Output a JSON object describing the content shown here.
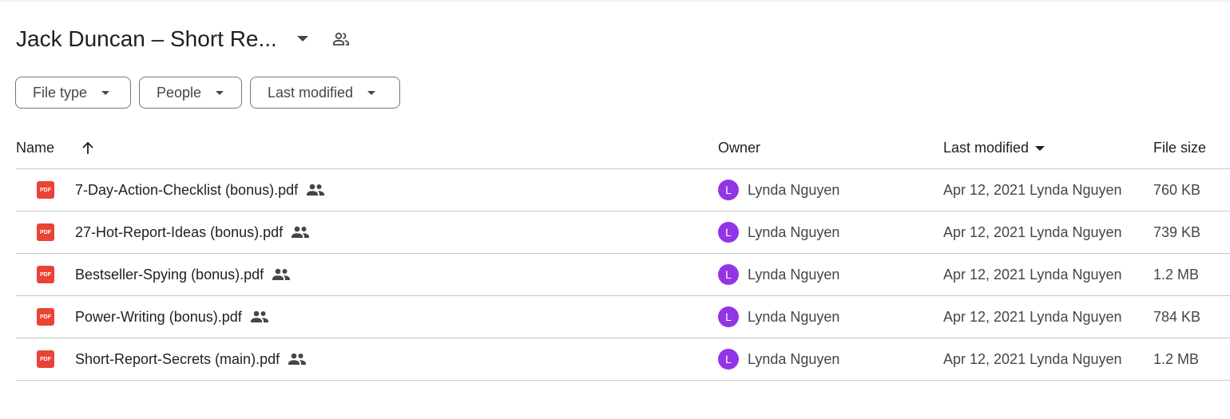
{
  "header": {
    "folder_title": "Jack Duncan – Short Re...",
    "dropdown_icon": "arrow-drop-down-icon",
    "shared_icon": "people-outline-icon"
  },
  "filters": [
    {
      "label": "File type"
    },
    {
      "label": "People"
    },
    {
      "label": "Last modified"
    }
  ],
  "table": {
    "columns": {
      "name": "Name",
      "owner": "Owner",
      "last_modified": "Last modified",
      "file_size": "File size"
    },
    "sort": {
      "name_arrow": "arrow-upward-icon",
      "modified_arrow": "arrow-drop-down-icon"
    },
    "rows": [
      {
        "icon_label": "PDF",
        "name": "7-Day-Action-Checklist (bonus).pdf",
        "owner_initial": "L",
        "owner": "Lynda Nguyen",
        "modified": "Apr 12, 2021 Lynda Nguyen",
        "size": "760 KB"
      },
      {
        "icon_label": "PDF",
        "name": "27-Hot-Report-Ideas (bonus).pdf",
        "owner_initial": "L",
        "owner": "Lynda Nguyen",
        "modified": "Apr 12, 2021 Lynda Nguyen",
        "size": "739 KB"
      },
      {
        "icon_label": "PDF",
        "name": "Bestseller-Spying (bonus).pdf",
        "owner_initial": "L",
        "owner": "Lynda Nguyen",
        "modified": "Apr 12, 2021 Lynda Nguyen",
        "size": "1.2 MB"
      },
      {
        "icon_label": "PDF",
        "name": "Power-Writing (bonus).pdf",
        "owner_initial": "L",
        "owner": "Lynda Nguyen",
        "modified": "Apr 12, 2021 Lynda Nguyen",
        "size": "784 KB"
      },
      {
        "icon_label": "PDF",
        "name": "Short-Report-Secrets (main).pdf",
        "owner_initial": "L",
        "owner": "Lynda Nguyen",
        "modified": "Apr 12, 2021 Lynda Nguyen",
        "size": "1.2 MB"
      }
    ]
  },
  "colors": {
    "pdf_icon": "#ea4335",
    "avatar": "#9334e6",
    "divider": "#c7c7c7"
  }
}
